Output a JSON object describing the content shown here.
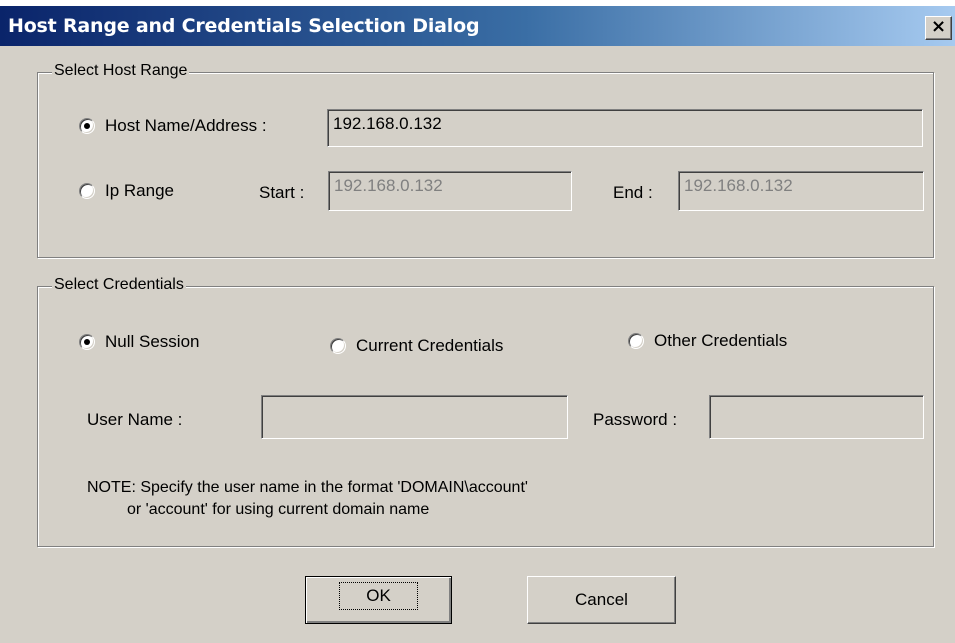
{
  "window": {
    "title": "Host Range and Credentials Selection Dialog",
    "close_label": "×"
  },
  "host_range": {
    "legend": "Select Host Range",
    "host_name_label": "Host Name/Address :",
    "host_name_value": "192.168.0.132",
    "host_name_checked": true,
    "ip_range_label": "Ip Range",
    "ip_range_checked": false,
    "start_label": "Start :",
    "start_value": "192.168.0.132",
    "end_label": "End :",
    "end_value": "192.168.0.132"
  },
  "credentials": {
    "legend": "Select Credentials",
    "options": [
      {
        "label": "Null Session",
        "checked": true
      },
      {
        "label": "Current Credentials",
        "checked": false
      },
      {
        "label": "Other Credentials",
        "checked": false
      }
    ],
    "username_label": "User Name :",
    "username_value": "",
    "password_label": "Password :",
    "password_value": "",
    "note": "NOTE: Specify the user name in the format 'DOMAIN\\account'\n         or 'account' for using current domain name"
  },
  "buttons": {
    "ok_label": "OK",
    "cancel_label": "Cancel"
  }
}
